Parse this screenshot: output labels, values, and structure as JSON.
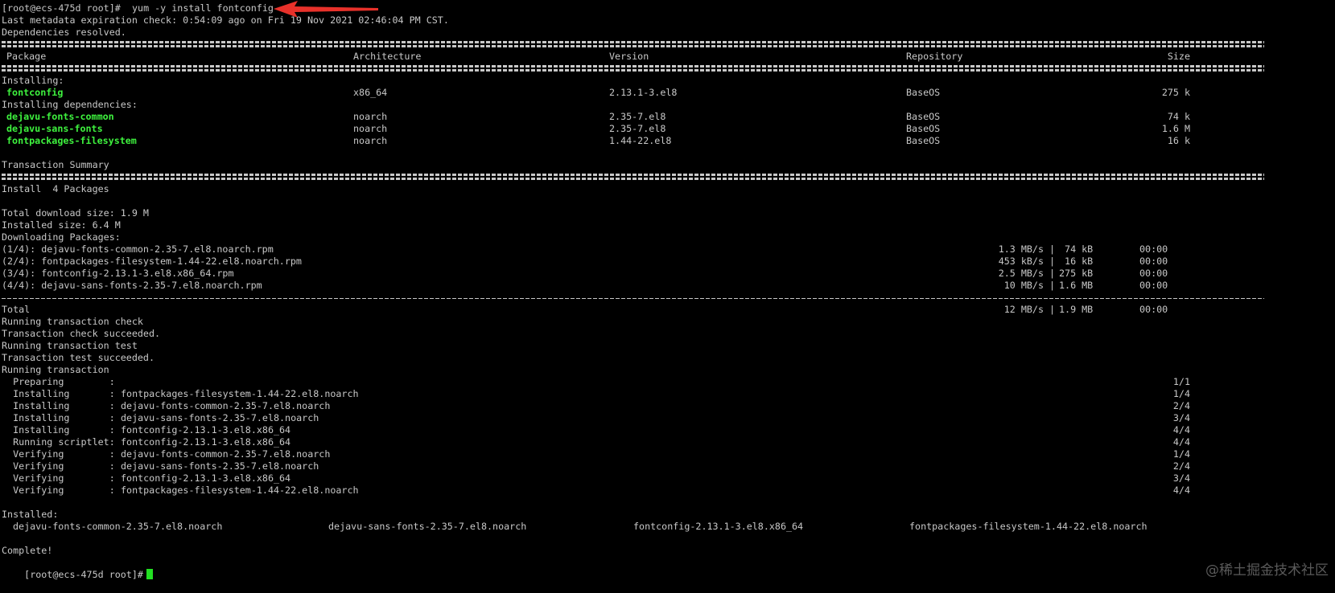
{
  "command": {
    "prompt": "[root@ecs-475d root]# ",
    "text": "yum -y install fontconfig"
  },
  "header_lines": [
    "Last metadata expiration check: 0:54:09 ago on Fri 19 Nov 2021 02:46:04 PM CST.",
    "Dependencies resolved."
  ],
  "table": {
    "columns": [
      "Package",
      "Architecture",
      "Version",
      "Repository",
      "Size"
    ],
    "installing_label": "Installing:",
    "installing": [
      {
        "name": "fontconfig",
        "arch": "x86_64",
        "version": "2.13.1-3.el8",
        "repo": "BaseOS",
        "size": "275 k"
      }
    ],
    "deps_label": "Installing dependencies:",
    "dependencies": [
      {
        "name": "dejavu-fonts-common",
        "arch": "noarch",
        "version": "2.35-7.el8",
        "repo": "BaseOS",
        "size": "74 k"
      },
      {
        "name": "dejavu-sans-fonts",
        "arch": "noarch",
        "version": "2.35-7.el8",
        "repo": "BaseOS",
        "size": "1.6 M"
      },
      {
        "name": "fontpackages-filesystem",
        "arch": "noarch",
        "version": "1.44-22.el8",
        "repo": "BaseOS",
        "size": "16 k"
      }
    ]
  },
  "summary": {
    "title": "Transaction Summary",
    "install_line": "Install  4 Packages",
    "lines": [
      "Total download size: 1.9 M",
      "Installed size: 6.4 M",
      "Downloading Packages:"
    ]
  },
  "downloads": [
    {
      "file": "(1/4): dejavu-fonts-common-2.35-7.el8.noarch.rpm",
      "speed": "1.3 MB/s",
      "size": " 74 kB",
      "time": "00:00"
    },
    {
      "file": "(2/4): fontpackages-filesystem-1.44-22.el8.noarch.rpm",
      "speed": "453 kB/s",
      "size": " 16 kB",
      "time": "00:00"
    },
    {
      "file": "(3/4): fontconfig-2.13.1-3.el8.x86_64.rpm",
      "speed": "2.5 MB/s",
      "size": "275 kB",
      "time": "00:00"
    },
    {
      "file": "(4/4): dejavu-sans-fonts-2.35-7.el8.noarch.rpm",
      "speed": "10 MB/s",
      "size": "1.6 MB",
      "time": "00:00"
    }
  ],
  "total": {
    "label": "Total",
    "speed": "12 MB/s",
    "size": "1.9 MB",
    "time": "00:00"
  },
  "transaction_lines": [
    "Running transaction check",
    "Transaction check succeeded.",
    "Running transaction test",
    "Transaction test succeeded.",
    "Running transaction"
  ],
  "steps": [
    {
      "action": "  Preparing        :",
      "item": "",
      "count": "1/1"
    },
    {
      "action": "  Installing       :",
      "item": "fontpackages-filesystem-1.44-22.el8.noarch",
      "count": "1/4"
    },
    {
      "action": "  Installing       :",
      "item": "dejavu-fonts-common-2.35-7.el8.noarch",
      "count": "2/4"
    },
    {
      "action": "  Installing       :",
      "item": "dejavu-sans-fonts-2.35-7.el8.noarch",
      "count": "3/4"
    },
    {
      "action": "  Installing       :",
      "item": "fontconfig-2.13.1-3.el8.x86_64",
      "count": "4/4"
    },
    {
      "action": "  Running scriptlet:",
      "item": "fontconfig-2.13.1-3.el8.x86_64",
      "count": "4/4"
    },
    {
      "action": "  Verifying        :",
      "item": "dejavu-fonts-common-2.35-7.el8.noarch",
      "count": "1/4"
    },
    {
      "action": "  Verifying        :",
      "item": "dejavu-sans-fonts-2.35-7.el8.noarch",
      "count": "2/4"
    },
    {
      "action": "  Verifying        :",
      "item": "fontconfig-2.13.1-3.el8.x86_64",
      "count": "3/4"
    },
    {
      "action": "  Verifying        :",
      "item": "fontpackages-filesystem-1.44-22.el8.noarch",
      "count": "4/4"
    }
  ],
  "installed": {
    "label": "Installed:",
    "packages": [
      "dejavu-fonts-common-2.35-7.el8.noarch",
      "dejavu-sans-fonts-2.35-7.el8.noarch",
      "fontconfig-2.13.1-3.el8.x86_64",
      "fontpackages-filesystem-1.44-22.el8.noarch"
    ]
  },
  "complete": "Complete!",
  "final_prompt": "[root@ecs-475d root]#",
  "watermark": "@稀土掘金技术社区",
  "colors": {
    "background": "#000000",
    "text": "#c8c8c8",
    "package": "#3ef23e",
    "cursor": "#22e022",
    "arrow": "#e8312a"
  }
}
